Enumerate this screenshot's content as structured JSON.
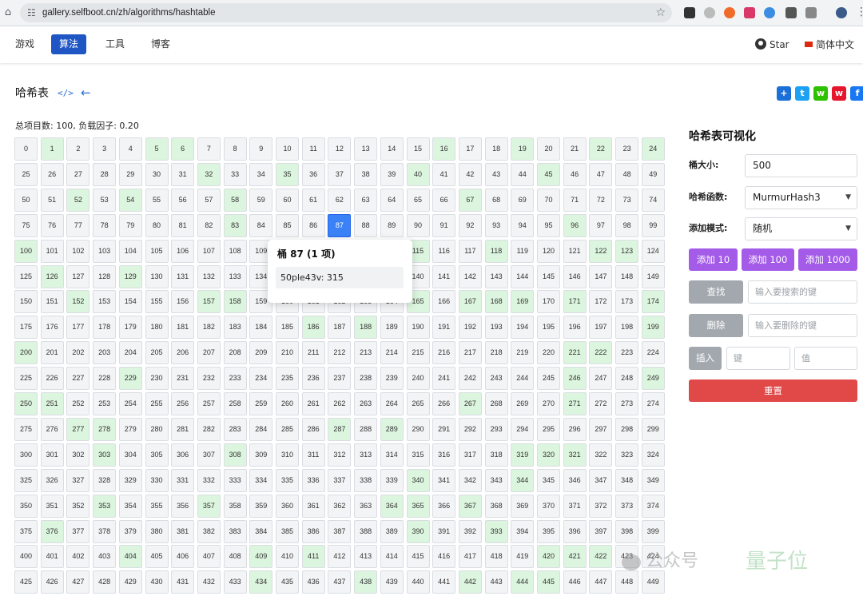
{
  "browser": {
    "url": "gallery.selfboot.cn/zh/algorithms/hashtable"
  },
  "nav": {
    "items": [
      "游戏",
      "算法",
      "工具",
      "博客"
    ],
    "active": "算法",
    "github_star": "Star",
    "language": "简体中文"
  },
  "page": {
    "title": "哈希表",
    "code_icon": "</>",
    "back_icon": "←",
    "stats": "总项目数: 100, 负载因子: 0.20"
  },
  "grid": {
    "first_visible": 0,
    "last_visible": 449,
    "columns": 25,
    "selected": 87,
    "occupied": [
      1,
      5,
      6,
      16,
      19,
      22,
      24,
      32,
      35,
      40,
      45,
      52,
      54,
      58,
      67,
      83,
      96,
      100,
      115,
      118,
      122,
      123,
      126,
      129,
      152,
      157,
      158,
      165,
      167,
      168,
      169,
      171,
      174,
      186,
      188,
      199,
      200,
      221,
      222,
      229,
      246,
      249,
      250,
      251,
      267,
      271,
      277,
      278,
      287,
      289,
      303,
      308,
      319,
      320,
      321,
      340,
      344,
      353,
      357,
      364,
      365,
      367,
      376,
      390,
      393,
      404,
      409,
      411,
      420,
      421,
      422,
      434,
      438,
      442,
      444,
      445
    ]
  },
  "tooltip": {
    "title": "桶 87 (1 项)",
    "entry": "50ple43v: 315"
  },
  "panel": {
    "title": "哈希表可视化",
    "bucket_size_label": "桶大小:",
    "bucket_size_value": "500",
    "hash_fn_label": "哈希函数:",
    "hash_fn_value": "MurmurHash3",
    "add_mode_label": "添加模式:",
    "add_mode_value": "随机",
    "add_buttons": [
      "添加 10",
      "添加 100",
      "添加 1000"
    ],
    "search_button": "查找",
    "search_placeholder": "输入要搜索的键",
    "delete_button": "删除",
    "delete_placeholder": "输入要删除的键",
    "insert_button": "插入",
    "key_placeholder": "键",
    "value_placeholder": "值",
    "reset_button": "重置"
  },
  "watermark": {
    "text1": "公众号",
    "text2": "量子位"
  },
  "colors": {
    "occupied": "#dcf5de",
    "empty": "#f3f4f6",
    "selected": "#3b82f6",
    "purple_button": "#a35be8",
    "gray_button": "#a3a8ae",
    "reset_button": "#e14848",
    "nav_active": "#1f56c4"
  }
}
